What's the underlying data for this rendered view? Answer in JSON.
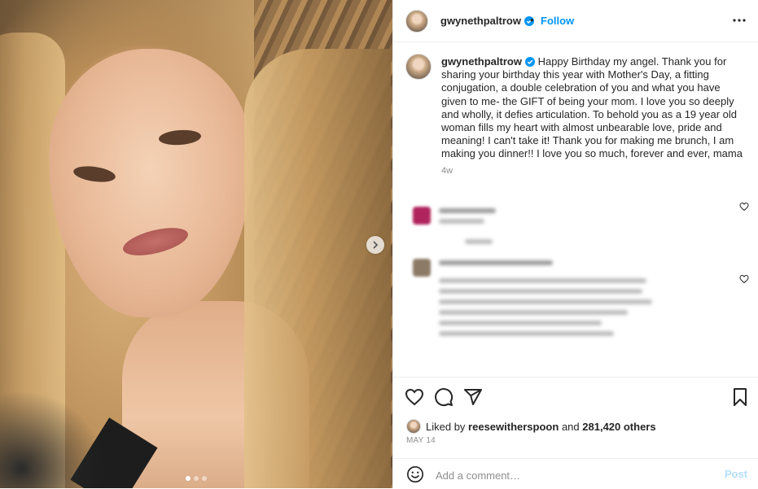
{
  "post": {
    "author": "gwynethpaltrow",
    "follow_label": "Follow",
    "separator": "•",
    "more_icon": "more-horizontal-icon",
    "carousel": {
      "total": 3,
      "active": 1
    }
  },
  "caption": {
    "username": "gwynethpaltrow",
    "text": "Happy Birthday my angel. Thank you for sharing your birthday this year with Mother's Day, a fitting conjugation, a double celebration of you and what you have given to me- the GIFT of being your mom. I love you so deeply and wholly, it defies articulation. To behold you as a 19 year old woman fills my heart with almost unbearable love, pride and meaning! I can't take it! Thank you for making me brunch, I am making you dinner!! I love you so much, forever and ever, mama",
    "time_ago": "4w"
  },
  "likes": {
    "prefix": "Liked by",
    "liker": "reesewitherspoon",
    "conjunction": "and",
    "others": "281,420 others"
  },
  "date": "MAY 14",
  "comment_box": {
    "placeholder": "Add a comment…",
    "post_label": "Post"
  },
  "colors": {
    "link": "#0095f6",
    "verified": "#0095f6",
    "post_disabled": "#b2dffc",
    "muted": "#8e8e8e"
  }
}
